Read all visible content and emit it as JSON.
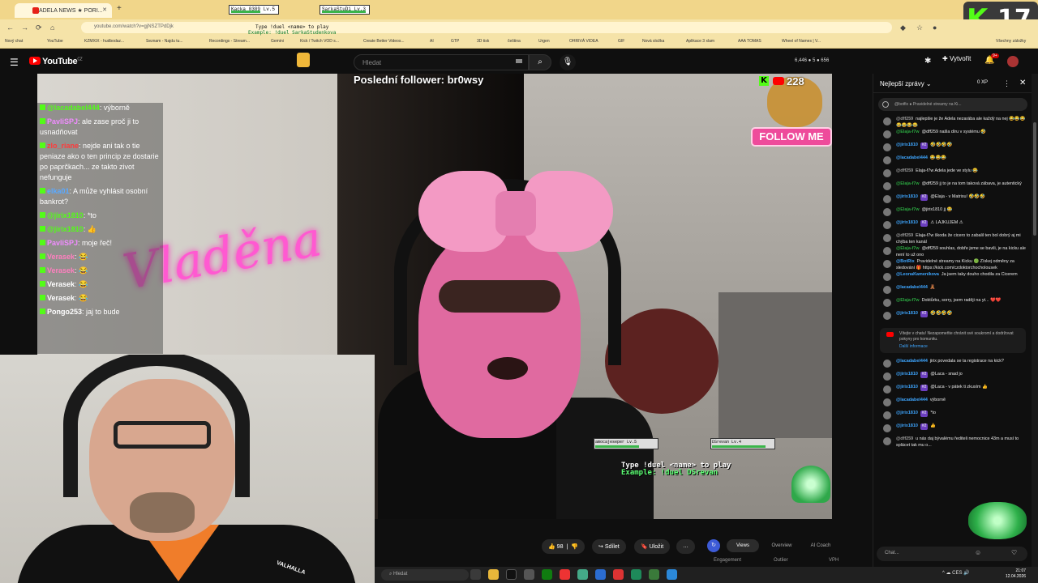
{
  "browser": {
    "tabs": [
      {
        "title": "ADELA NEWS ★ PORI..."
      }
    ],
    "new_tab": "+",
    "url": "youtube.com/watch?v=gjNSZTPdDjk",
    "bookmarks": [
      "Nový chat",
      "YouTube",
      "KZMXIX - hudbodaz...",
      "Seznam - Najdu tu...",
      "Recordings - Stream...",
      "Gemini",
      "Kick / Twitch VOD s...",
      "Create Better Videos...",
      "AI",
      "GTP",
      "3D tisk",
      "čeština",
      "Urgen",
      "OHRIVÁ VIDEA",
      "GIF",
      "Nová složka",
      "Aplikace 3 xlam",
      "AAA TOMAS",
      "Wheel of Names | V...",
      "Všechny záložky"
    ],
    "overlay_bars": [
      {
        "label": "Kacka_0309  Lv.5",
        "hp": 0.6
      },
      {
        "label": "SarkaStuDi  Lv.3",
        "hp": 0.9
      }
    ],
    "cmd_line1": "Type !duel <name> to play",
    "cmd_line2": "Example: !duel SarkaStudenkova"
  },
  "kick_counter": {
    "letter": "K",
    "count": "17"
  },
  "youtube": {
    "logo": "YouTube",
    "logo_country": "CZ",
    "search_placeholder": "Hledat",
    "stats": "6,446 ● 5 ● 656",
    "create_label": "Vytvořit",
    "notif_badge": "9+"
  },
  "video": {
    "last_follower": "Poslední follower: br0wsy",
    "follow_count": "228",
    "follow_k": "K",
    "follow_button": "FOLLOW ME",
    "neon_text": "Vladěna",
    "overlay_chat": [
      {
        "user": "@lacadabel444",
        "text": ": výborně",
        "color": "#53fc18"
      },
      {
        "user": "PavliSPJ",
        "text": ": ale zase proč ji to usnadňovat",
        "color": "#f08cff"
      },
      {
        "user": "zlo_riane",
        "text": ": nejde ani tak o tie peniaze ako o ten princip ze dostarie po paprčkach... ze takto zivot nefunguje",
        "color": "#ff3b3b"
      },
      {
        "user": "elka01",
        "text": ": A může vyhlásit osobní bankrot?",
        "color": "#5aa9ff"
      },
      {
        "user": "@jirix1810",
        "text": ": *to",
        "color": "#53fc18"
      },
      {
        "user": "@jirix1810",
        "text": ": 👍",
        "color": "#53fc18"
      },
      {
        "user": "PavliSPJ",
        "text": ": moje řeč!",
        "color": "#f08cff"
      },
      {
        "user": "Verasek",
        "text": ": 😂",
        "color": "#ff7fbf"
      },
      {
        "user": "Verasek",
        "text": ": 😂",
        "color": "#ff7fbf"
      },
      {
        "user": "Verasek",
        "text": ": 😂",
        "color": "#ffffff"
      },
      {
        "user": "Verasek",
        "text": ": 😂",
        "color": "#ffffff"
      },
      {
        "user": "Pongo253",
        "text": ": jaj to bude",
        "color": "#ffffff"
      }
    ],
    "duel_bars": [
      {
        "label": "amocajeseper Lv.5",
        "hp": 0.7
      },
      {
        "label": "DSrevan Lv.4",
        "hp": 0.85
      }
    ],
    "duel_line1": "Type !duel <name> to play",
    "duel_line2": "Example: !duel DSrevan",
    "cam_shirt_text": "VALHALLA"
  },
  "actions": {
    "likes": "98",
    "share": "Sdílet",
    "save": "Uložit",
    "more": "…"
  },
  "studio": {
    "tabs": [
      "Views",
      "Overview",
      "AI Coach"
    ],
    "sub": [
      "Engagement",
      "Outlier",
      "VPH"
    ]
  },
  "chat": {
    "mode": "Nejlepší zprávy",
    "points": "0 XP",
    "pinned": "@botfix ● Pravidelné streamy na Ki...",
    "input_placeholder": "Chat...",
    "messages": [
      {
        "user": "@dff259",
        "badge": "",
        "text": "najlepšie je že Adela nezarába ale každý na nej 😂😂😂😂😂😂😂",
        "color": "#9b9b9b"
      },
      {
        "user": "@Elaja-f7w",
        "badge": "",
        "text": "@dff259 našla díru v systému 🤣",
        "color": "#2ba640"
      },
      {
        "user": "@jirix1810",
        "badge": "#2",
        "text": "🤣🤣🤣🤣",
        "color": "#3ea6ff"
      },
      {
        "user": "@lacadabel444",
        "badge": "",
        "text": "😂😂😂",
        "color": "#3ea6ff"
      },
      {
        "user": "@dff259",
        "badge": "",
        "text": "Elaja-f7w Adela jede ve stylu 😂",
        "color": "#9b9b9b"
      },
      {
        "user": "@Elaja-f7w",
        "badge": "",
        "text": "@dff259 jj to je na tom taková zábava, je autentický",
        "color": "#2ba640"
      },
      {
        "user": "@jirix1810",
        "badge": "#2",
        "text": "@Elaja - v Matrixu! 🤣🤣🤣",
        "color": "#3ea6ff"
      },
      {
        "user": "@Elaja-f7w",
        "badge": "",
        "text": "@jirix1810 jj 😂",
        "color": "#2ba640"
      },
      {
        "user": "@jirix1810",
        "badge": "#2",
        "text": "⚠ LAJKUJEM ⚠",
        "color": "#3ea6ff"
      },
      {
        "user": "@dff259",
        "badge": "",
        "text": "Elaja-f7w škoda že cicero to zabalil ten bol dobrý aj mi chýba ten kanál",
        "color": "#9b9b9b"
      },
      {
        "user": "@Elaja-f7w",
        "badge": "",
        "text": "@dff259 souhlas, dobře jsme se bavili, je na kicku ale není to už ono",
        "color": "#2ba640"
      },
      {
        "user": "@BotRix",
        "badge": "",
        "text": "Pravidelné streamy na Kicku 🟢 Získej odměny za sledování 🎁 https://kick.com/czdoktorchocholousek",
        "color": "#3ea6ff"
      },
      {
        "user": "@LeonaKamenikova",
        "badge": "",
        "text": "Ja jsem taky douho chodila za Cicerem",
        "color": "#3ea6ff"
      },
      {
        "user": "@lacadabel444",
        "badge": "",
        "text": "🧸",
        "color": "#3ea6ff"
      },
      {
        "user": "@Elaja-f7w",
        "badge": "",
        "text": "Doktůrku, sorry, jsem raději na yt... ❤️❤️",
        "color": "#2ba640"
      },
      {
        "user": "@jirix1810",
        "badge": "#2",
        "text": "🤣🤣🤣🤣",
        "color": "#3ea6ff"
      }
    ],
    "system_notice": "Vítejte v chatu! Nezapomeňte chránit své soukromí a dodržovat pokyny pro komunitu.",
    "system_more": "Další informace",
    "messages2": [
      {
        "user": "@lacadabel444",
        "badge": "",
        "text": "jirix povedala se ta registrace na kick?",
        "color": "#3ea6ff"
      },
      {
        "user": "@jirix1810",
        "badge": "#2",
        "text": "@Laca - snad jo",
        "color": "#3ea6ff"
      },
      {
        "user": "@jirix1810",
        "badge": "#2",
        "text": "@Laca - v pátek ti zkusím 👍",
        "color": "#3ea6ff"
      },
      {
        "user": "@lacadabel444",
        "badge": "",
        "text": "výborně",
        "color": "#3ea6ff"
      },
      {
        "user": "@jirix1810",
        "badge": "#2",
        "text": "*to",
        "color": "#3ea6ff"
      },
      {
        "user": "@jirix1810",
        "badge": "#2",
        "text": "👍",
        "color": "#3ea6ff"
      },
      {
        "user": "@dff259",
        "badge": "",
        "text": "u nás daj bývalému řediteli nemocnice 43m a musí to splácet tak mu o...",
        "color": "#9b9b9b"
      }
    ]
  },
  "taskbar": {
    "search": "Hledat",
    "tray": "^ ☁ CES 🔊",
    "time": "21:07",
    "date": "12.04.2026"
  }
}
